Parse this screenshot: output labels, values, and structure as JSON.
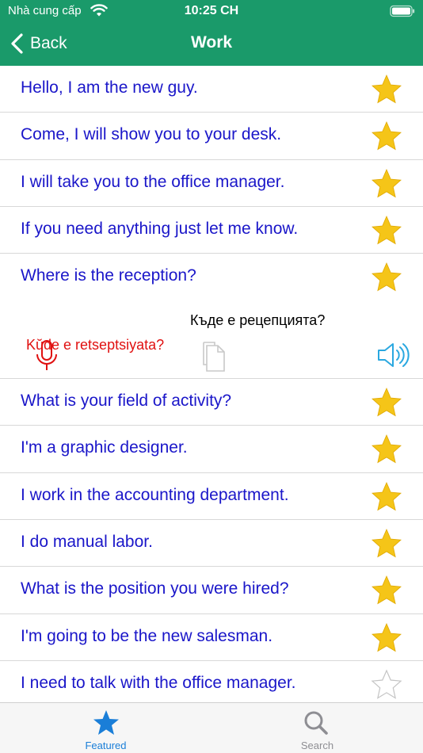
{
  "status_bar": {
    "carrier": "Nhà cung cấp",
    "time": "10:25 CH"
  },
  "nav": {
    "back_label": "Back",
    "title": "Work"
  },
  "colors": {
    "header": "#1a9a6a",
    "phrase": "#1a16c9",
    "translit": "#e01010",
    "star": "#f5c518",
    "tab_active": "#1a7ed8"
  },
  "phrases": [
    {
      "text": "Hello, I am the new guy.",
      "starred": true
    },
    {
      "text": "Come, I will show you to your desk.",
      "starred": true
    },
    {
      "text": "I will take you to the office manager.",
      "starred": true
    },
    {
      "text": "If you need anything just let me know.",
      "starred": true
    },
    {
      "text": "Where is the reception?",
      "starred": true,
      "translation": "Къде е рецепцията?",
      "transliteration": "Kŭde e retseptsiyata?"
    },
    {
      "text": "What is your field of activity?",
      "starred": true
    },
    {
      "text": "I'm a graphic designer.",
      "starred": true
    },
    {
      "text": "I work in the accounting department.",
      "starred": true
    },
    {
      "text": "I do manual labor.",
      "starred": true
    },
    {
      "text": "What is the position you were hired?",
      "starred": true
    },
    {
      "text": "I'm going to be the new salesman.",
      "starred": true
    },
    {
      "text": "I need to talk with the office manager.",
      "starred": false
    }
  ],
  "tabs": [
    {
      "label": "Featured",
      "icon": "star-icon",
      "active": true
    },
    {
      "label": "Search",
      "icon": "search-icon",
      "active": false
    }
  ]
}
